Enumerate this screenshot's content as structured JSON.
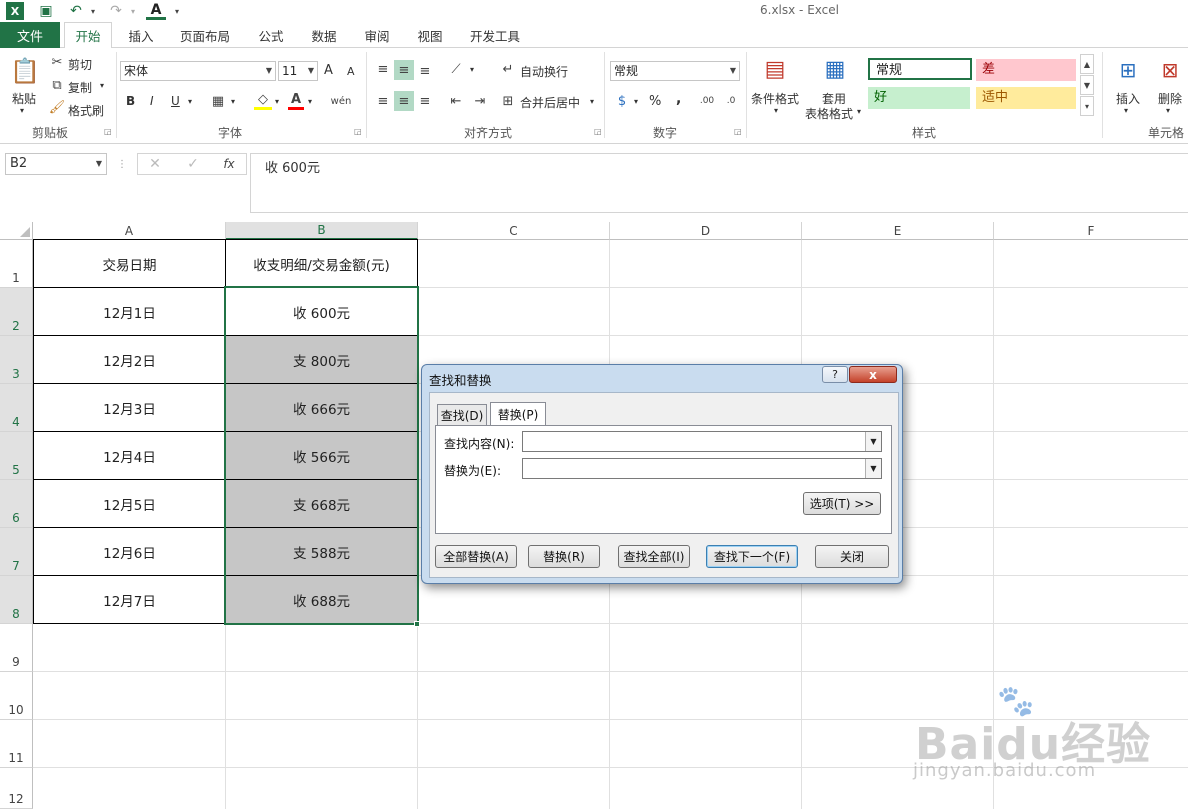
{
  "titlebar": {
    "title": "6.xlsx - Excel",
    "font_color_letter": "A"
  },
  "ribbon_tabs": {
    "file": "文件",
    "tabs": [
      "开始",
      "插入",
      "页面布局",
      "公式",
      "数据",
      "审阅",
      "视图",
      "开发工具"
    ],
    "active": "开始"
  },
  "clipboard": {
    "paste": "粘贴",
    "cut": "剪切",
    "copy": "复制",
    "format_painter": "格式刷",
    "label": "剪贴板"
  },
  "font": {
    "name": "宋体",
    "size": "11",
    "bold": "B",
    "italic": "I",
    "underline": "U",
    "grow": "A",
    "shrink": "A",
    "label": "字体"
  },
  "alignment": {
    "wrap_text": "自动换行",
    "merge_center": "合并后居中",
    "label": "对齐方式"
  },
  "number": {
    "format": "常规",
    "percent": "%",
    "comma": ",",
    "label": "数字"
  },
  "styles": {
    "conditional": "条件格式",
    "table_format_1": "套用",
    "table_format_2": "表格格式",
    "normal": "常规",
    "bad": "差",
    "good": "好",
    "neutral": "适中",
    "label": "样式",
    "colors": {
      "normal_border": "#217346",
      "bad_bg": "#ffc7ce",
      "bad_fg": "#9c0006",
      "good_bg": "#c6efce",
      "good_fg": "#006100",
      "neutral_bg": "#ffeb9c",
      "neutral_fg": "#9c5700"
    }
  },
  "cells_group": {
    "insert": "插入",
    "delete": "删除",
    "label": "单元格"
  },
  "formula_bar": {
    "name_box": "B2",
    "content": "收 600元"
  },
  "sheet": {
    "columns": [
      "A",
      "B",
      "C",
      "D",
      "E",
      "F"
    ],
    "rows": [
      "1",
      "2",
      "3",
      "4",
      "5",
      "6",
      "7",
      "8",
      "9",
      "10",
      "11",
      "12"
    ],
    "data": [
      [
        "交易日期",
        "收支明细/交易金额(元)"
      ],
      [
        "12月1日",
        "收 600元"
      ],
      [
        "12月2日",
        "支 800元"
      ],
      [
        "12月3日",
        "收 666元"
      ],
      [
        "12月4日",
        "收 566元"
      ],
      [
        "12月5日",
        "支 668元"
      ],
      [
        "12月6日",
        "支 588元"
      ],
      [
        "12月7日",
        "收 688元"
      ]
    ],
    "selection": "B2:B8",
    "accent": "#217346"
  },
  "dialog": {
    "title": "查找和替换",
    "help": "?",
    "close": "x",
    "tab_find": "查找(D)",
    "tab_replace": "替换(P)",
    "find_label": "查找内容(N):",
    "find_value": "",
    "replace_label": "替换为(E):",
    "replace_value": "",
    "options": "选项(T) >>",
    "replace_all": "全部替换(A)",
    "replace": "替换(R)",
    "find_all": "查找全部(I)",
    "find_next": "查找下一个(F)",
    "close_btn": "关闭"
  },
  "watermark": {
    "main": "Baidu经验",
    "sub": "jingyan.baidu.com"
  }
}
